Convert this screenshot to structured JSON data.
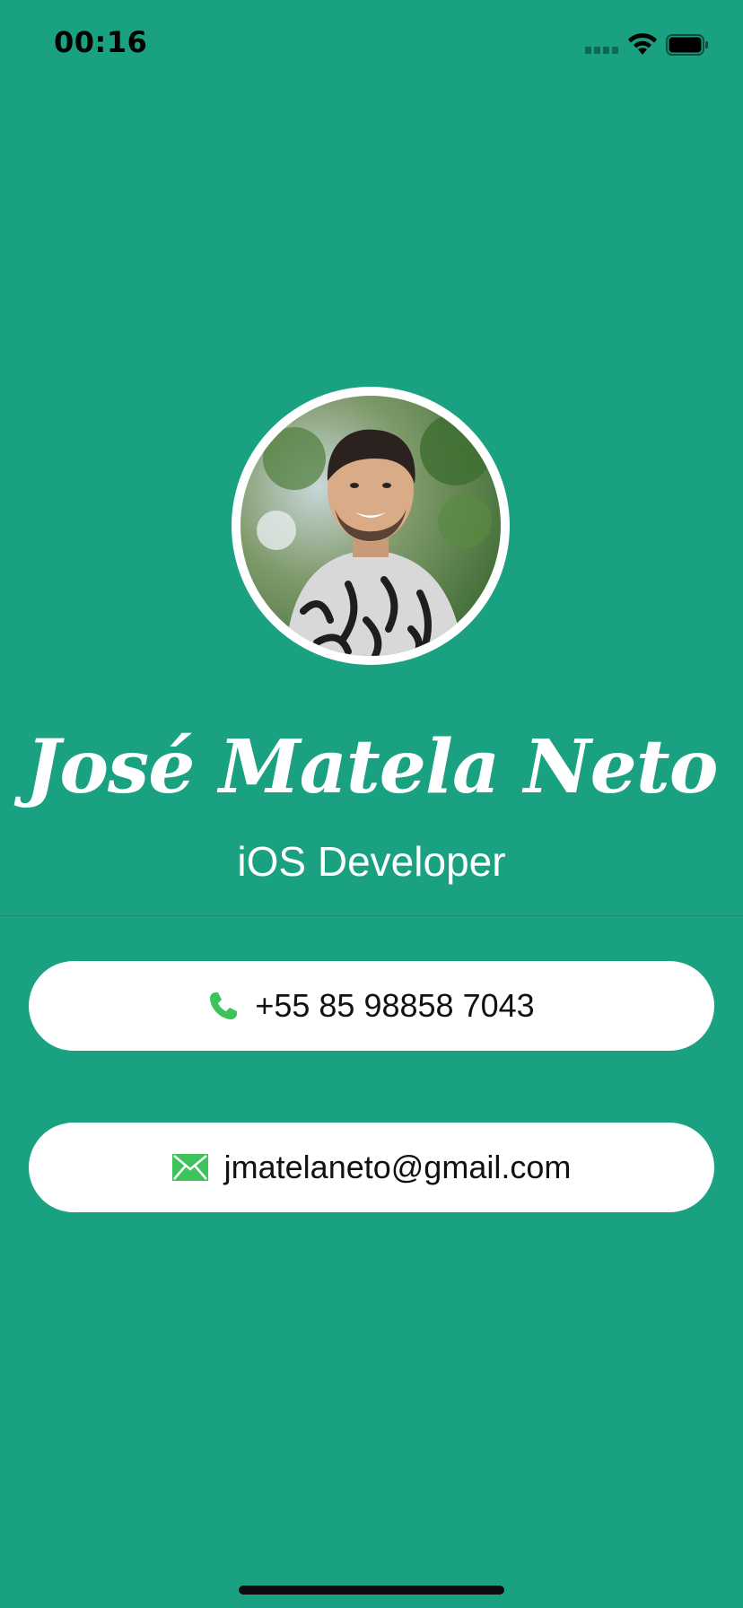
{
  "status_bar": {
    "time": "00:16"
  },
  "profile": {
    "name": "José Matela Neto",
    "role": "iOS Developer",
    "avatar_icon": "profile-photo"
  },
  "contacts": {
    "phone": {
      "icon": "phone-icon",
      "value": "+55 85 98858 7043"
    },
    "email": {
      "icon": "envelope-icon",
      "value": "jmatelaneto@gmail.com"
    }
  },
  "colors": {
    "background": "#1aa182",
    "card": "#ffffff",
    "icon_green": "#3cc45a",
    "text_dark": "#111111"
  }
}
